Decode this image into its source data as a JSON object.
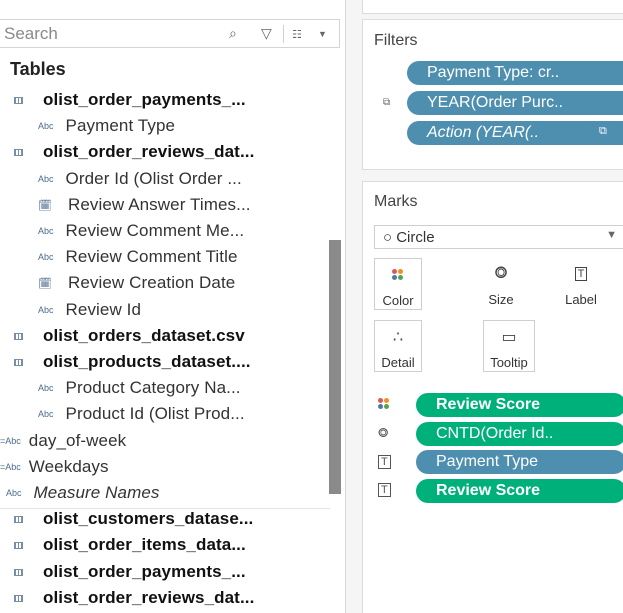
{
  "data_pane": {
    "search_placeholder": "Search",
    "tables_title": "Tables",
    "items": [
      {
        "kind": "table",
        "icon": "table-icon",
        "label": "olist_order_payments_..."
      },
      {
        "kind": "string",
        "icon": "abc-icon",
        "label": "Payment Type"
      },
      {
        "kind": "table",
        "icon": "table-icon",
        "label": "olist_order_reviews_dat..."
      },
      {
        "kind": "string",
        "icon": "abc-icon",
        "label": "Order Id (Olist Order ..."
      },
      {
        "kind": "date",
        "icon": "calendar-icon",
        "label": "Review Answer Times..."
      },
      {
        "kind": "string",
        "icon": "abc-icon",
        "label": "Review Comment Me..."
      },
      {
        "kind": "string",
        "icon": "abc-icon",
        "label": "Review Comment Title"
      },
      {
        "kind": "date",
        "icon": "calendar-icon",
        "label": "Review Creation Date"
      },
      {
        "kind": "string",
        "icon": "abc-icon",
        "label": "Review Id"
      },
      {
        "kind": "table",
        "icon": "table-icon",
        "label": "olist_orders_dataset.csv"
      },
      {
        "kind": "table",
        "icon": "table-icon",
        "label": "olist_products_dataset...."
      },
      {
        "kind": "string",
        "icon": "abc-icon",
        "label": "Product Category Na..."
      },
      {
        "kind": "string",
        "icon": "abc-icon",
        "label": "Product Id (Olist Prod..."
      },
      {
        "kind": "calc",
        "icon": "calc-abc-icon",
        "label": "day_of-week"
      },
      {
        "kind": "calc",
        "icon": "calc-abc-icon",
        "label": "Weekdays"
      },
      {
        "kind": "measure-names",
        "icon": "abc-icon",
        "label": "Measure Names"
      },
      {
        "kind": "table",
        "icon": "table-icon",
        "label": "olist_customers_datase..."
      },
      {
        "kind": "table",
        "icon": "table-icon",
        "label": "olist_order_items_data..."
      },
      {
        "kind": "table",
        "icon": "table-icon",
        "label": "olist_order_payments_..."
      },
      {
        "kind": "table",
        "icon": "table-icon",
        "label": "olist_order_reviews_dat..."
      }
    ]
  },
  "filters": {
    "title": "Filters",
    "pills": [
      {
        "label": "Payment Type: cr..",
        "color": "#4e8fb0"
      },
      {
        "label": "YEAR(Order Purc..",
        "color": "#4e8fb0"
      },
      {
        "label": "Action (YEAR(..",
        "color": "#4e8fb0"
      }
    ]
  },
  "marks": {
    "title": "Marks",
    "mark_type": "○ Circle",
    "buttons": {
      "color": "Color",
      "size": "Size",
      "label": "Label",
      "detail": "Detail",
      "tooltip": "Tooltip"
    },
    "fields": [
      {
        "role": "color",
        "icon": "color-icon",
        "label": "Review Score",
        "color": "#00b07a"
      },
      {
        "role": "size",
        "icon": "size-icon",
        "label": "CNTD(Order Id..",
        "color": "#00b07a"
      },
      {
        "role": "label",
        "icon": "label-icon",
        "label": "Payment Type",
        "color": "#4e8fb0"
      },
      {
        "role": "label",
        "icon": "label-icon",
        "label": "Review Score",
        "color": "#00b07a"
      }
    ]
  },
  "colors": {
    "dimension_pill": "#4e8fb0",
    "measure_pill": "#00b07a"
  }
}
